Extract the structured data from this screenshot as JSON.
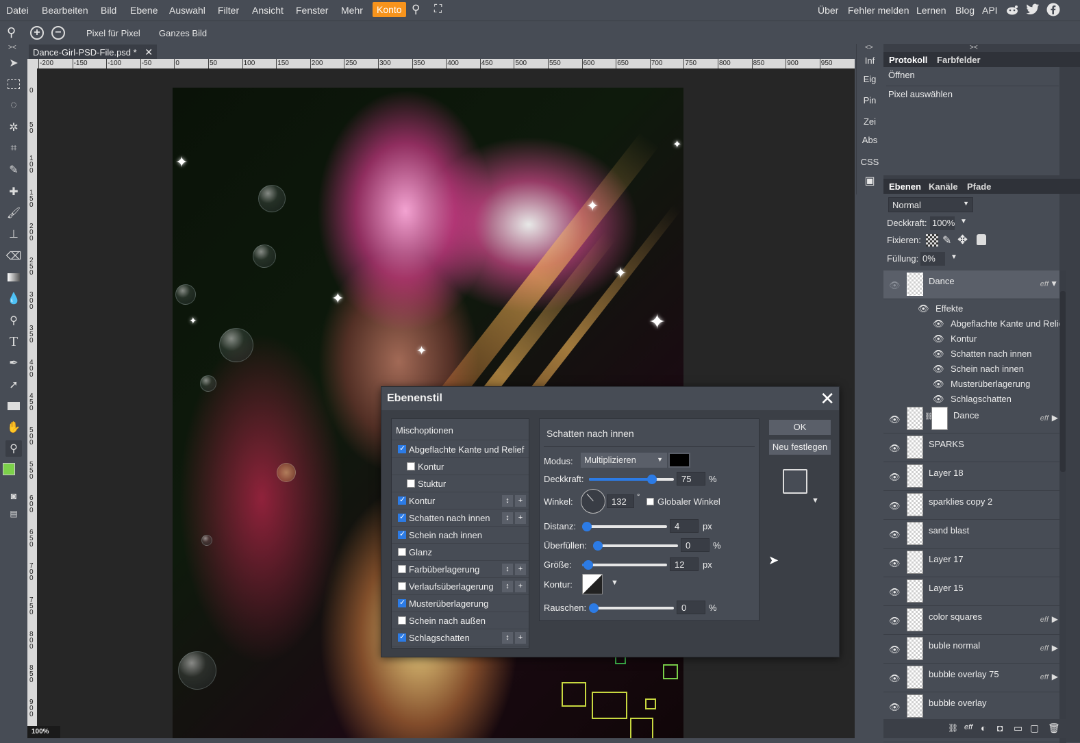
{
  "menu": {
    "items": [
      "Datei",
      "Bearbeiten",
      "Bild",
      "Ebene",
      "Auswahl",
      "Filter",
      "Ansicht",
      "Fenster",
      "Mehr",
      "Konto"
    ],
    "right": [
      "Über",
      "Fehler melden",
      "Lernen",
      "Blog",
      "API"
    ]
  },
  "options": {
    "pixel_label": "Pixel für Pixel",
    "whole_label": "Ganzes Bild"
  },
  "document": {
    "tab_label": "Dance-Girl-PSD-File.psd *",
    "zoom": "100%"
  },
  "ruler": {
    "h_labels": [
      "-200",
      "-150",
      "-100",
      "-50",
      "0",
      "50",
      "100",
      "150",
      "200",
      "250",
      "300",
      "350",
      "400",
      "450",
      "500",
      "550",
      "600",
      "650",
      "700",
      "750",
      "800",
      "850",
      "900",
      "950"
    ],
    "v_labels": [
      "0",
      "5 0",
      "1 0 0",
      "1 5 0",
      "2 0 0",
      "2 5 0",
      "3 0 0",
      "3 5 0",
      "4 0 0",
      "4 5 0",
      "5 0 0",
      "5 5 0",
      "6 0 0",
      "6 5 0",
      "7 0 0",
      "7 5 0",
      "8 0 0",
      "8 5 0",
      "9 0 0"
    ]
  },
  "mid_panel": [
    "Inf",
    "Eig",
    "Pin",
    "Zei",
    "Abs",
    "CSS"
  ],
  "history": {
    "tabs": [
      "Protokoll",
      "Farbfelder"
    ],
    "items": [
      "Öffnen",
      "Pixel auswählen"
    ]
  },
  "layers_panel": {
    "tabs": [
      "Ebenen",
      "Kanäle",
      "Pfade"
    ],
    "blend_mode": "Normal",
    "opacity_label": "Deckkraft:",
    "opacity_value": "100%",
    "lock_label": "Fixieren:",
    "fill_label": "Füllung:",
    "fill_value": "0%",
    "effects_header": "Effekte",
    "effects": [
      "Abgeflachte Kante und Relief",
      "Kontur",
      "Schatten nach innen",
      "Schein nach innen",
      "Musterüberlagerung",
      "Schlagschatten"
    ],
    "eff_tag": "eff",
    "layers": [
      {
        "name": "Dance",
        "eff": true,
        "selected": true
      },
      {
        "name": "Dance",
        "eff": true,
        "mask": true
      },
      {
        "name": "SPARKS",
        "eff": false
      },
      {
        "name": "Layer 18",
        "eff": false
      },
      {
        "name": "sparklies copy 2",
        "eff": false
      },
      {
        "name": "sand blast",
        "eff": false
      },
      {
        "name": "Layer 17",
        "eff": false
      },
      {
        "name": "Layer 15",
        "eff": false
      },
      {
        "name": "color squares",
        "eff": true
      },
      {
        "name": "buble normal",
        "eff": true
      },
      {
        "name": "bubble overlay 75",
        "eff": true
      },
      {
        "name": "bubble overlay",
        "eff": false
      }
    ]
  },
  "dialog": {
    "title": "Ebenenstil",
    "blend_options": "Mischoptionen",
    "styles": [
      {
        "label": "Abgeflachte Kante und Relief",
        "checked": true,
        "indent": false,
        "buttons": false
      },
      {
        "label": "Kontur",
        "checked": false,
        "indent": true,
        "buttons": false
      },
      {
        "label": "Stuktur",
        "checked": false,
        "indent": true,
        "buttons": false
      },
      {
        "label": "Kontur",
        "checked": true,
        "indent": false,
        "buttons": true
      },
      {
        "label": "Schatten nach innen",
        "checked": true,
        "indent": false,
        "buttons": true
      },
      {
        "label": "Schein nach innen",
        "checked": true,
        "indent": false,
        "buttons": false
      },
      {
        "label": "Glanz",
        "checked": false,
        "indent": false,
        "buttons": false
      },
      {
        "label": "Farbüberlagerung",
        "checked": false,
        "indent": false,
        "buttons": true
      },
      {
        "label": "Verlaufsüberlagerung",
        "checked": false,
        "indent": false,
        "buttons": true
      },
      {
        "label": "Musterüberlagerung",
        "checked": true,
        "indent": false,
        "buttons": false
      },
      {
        "label": "Schein nach außen",
        "checked": false,
        "indent": false,
        "buttons": false
      },
      {
        "label": "Schlagschatten",
        "checked": true,
        "indent": false,
        "buttons": true
      }
    ],
    "section_title": "Schatten nach innen",
    "mode_label": "Modus:",
    "mode_value": "Multiplizieren",
    "opacity_label": "Deckkraft:",
    "opacity_value": "75",
    "opacity_unit": "%",
    "angle_label": "Winkel:",
    "angle_value": "132",
    "angle_unit": "°",
    "global_angle_label": "Globaler Winkel",
    "distance_label": "Distanz:",
    "distance_value": "4",
    "distance_unit": "px",
    "choke_label": "Überfüllen:",
    "choke_value": "0",
    "choke_unit": "%",
    "size_label": "Größe:",
    "size_value": "12",
    "size_unit": "px",
    "contour_label": "Kontur:",
    "noise_label": "Rauschen:",
    "noise_value": "0",
    "noise_unit": "%",
    "ok_label": "OK",
    "reset_label": "Neu festlegen"
  }
}
